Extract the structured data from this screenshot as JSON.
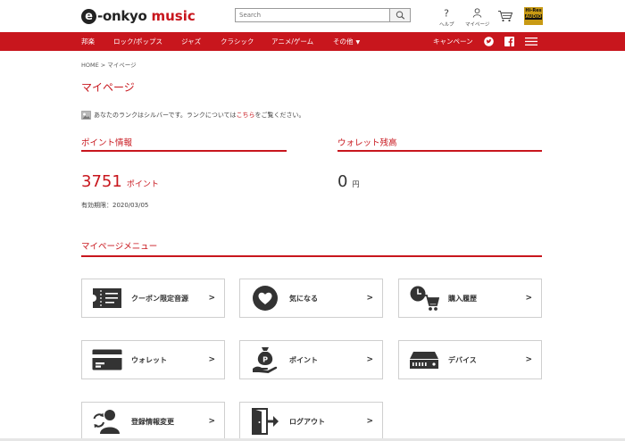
{
  "header": {
    "logo_text": "onkyo",
    "logo_music": "music",
    "search_placeholder": "Search",
    "help_label": "ヘルプ",
    "mypage_label": "マイページ",
    "hires_line1": "Hi-Res",
    "hires_line2": "AUDIO"
  },
  "nav": {
    "items": [
      "邦楽",
      "ロック/ポップス",
      "ジャズ",
      "クラシック",
      "アニメ/ゲーム",
      "その他"
    ],
    "campaign": "キャンペーン",
    "accent_color": "#c8161d"
  },
  "content": {
    "breadcrumb": "HOME > マイページ",
    "page_title": "マイページ",
    "rank_prefix": "あなたのランクはシルバーです。ランクについては",
    "rank_link": "こちら",
    "rank_suffix": "をご覧ください。",
    "points_title": "ポイント情報",
    "points_value": "3751",
    "points_unit": "ポイント",
    "expiry": "有効期限：2020/03/05",
    "wallet_title": "ウォレット残高",
    "wallet_value": "0",
    "wallet_unit": "円",
    "menu_title": "マイページメニュー"
  },
  "menu": [
    {
      "label": "クーポン限定音源",
      "icon": "coupon-icon"
    },
    {
      "label": "気になる",
      "icon": "heart-icon"
    },
    {
      "label": "購入履歴",
      "icon": "cart-history-icon"
    },
    {
      "label": "ウォレット",
      "icon": "wallet-card-icon"
    },
    {
      "label": "ポイント",
      "icon": "point-bag-icon"
    },
    {
      "label": "デバイス",
      "icon": "device-icon"
    },
    {
      "label": "登録情報変更",
      "icon": "user-update-icon"
    },
    {
      "label": "ログアウト",
      "icon": "logout-icon"
    }
  ],
  "arrow": ">"
}
